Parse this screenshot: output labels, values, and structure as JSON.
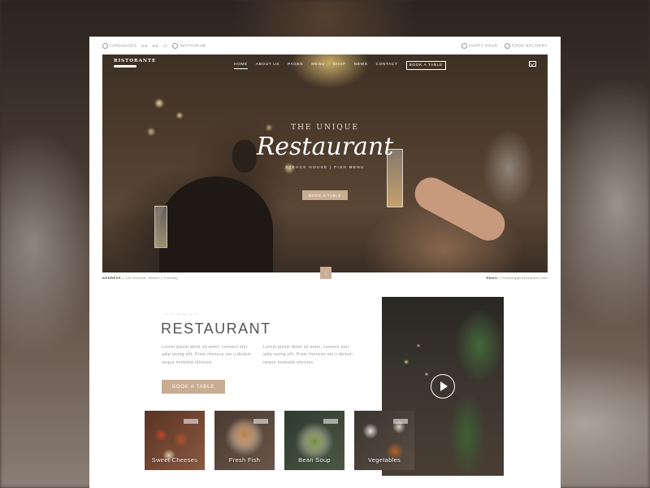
{
  "topbar": {
    "languages_label": "LANGUAGES",
    "lang_en": "EN",
    "lang_es": "ES",
    "lang_it": "IT",
    "instagram": "INSTAGRAM",
    "happy_hour": "HAPPY HOUR",
    "food_delivery": "FOOD DELIVERY"
  },
  "header": {
    "logo": "RISTORANTE",
    "nav": [
      "HOME",
      "ABOUT US",
      "PAGES",
      "MENU",
      "SHOP",
      "NEWS",
      "CONTACT"
    ],
    "book_label": "BOOK A TABLE"
  },
  "hero": {
    "subtitle": "THE UNIQUE",
    "title": "Restaurant",
    "tagline": "STEACK HOUSE | FISH MENU",
    "button": "BOOK A TABLE"
  },
  "info": {
    "address_label": "ADDRESS",
    "address_value": "| 145 Avenue, Miami ( Florida)",
    "email_label": "EMAIL",
    "email_value": "| booking@restaurant.com"
  },
  "about": {
    "title": "RESTAURANT",
    "para1": "Lorem ipsum dolor sit amet, consect etur adip iscing elit. Proin rhoncus uin u dictum neque molestie ultricies.",
    "para2": "Lorem ipsum dolor sit amet, consect etur adip iscing elit. Proin rhoncus uin u dictum neque molestie ultricies.",
    "button": "BOOK A TABLE"
  },
  "cards": [
    {
      "label": "Sweet Cheeses"
    },
    {
      "label": "Fresh Fish"
    },
    {
      "label": "Bean Soup"
    },
    {
      "label": "Vegetables"
    }
  ]
}
